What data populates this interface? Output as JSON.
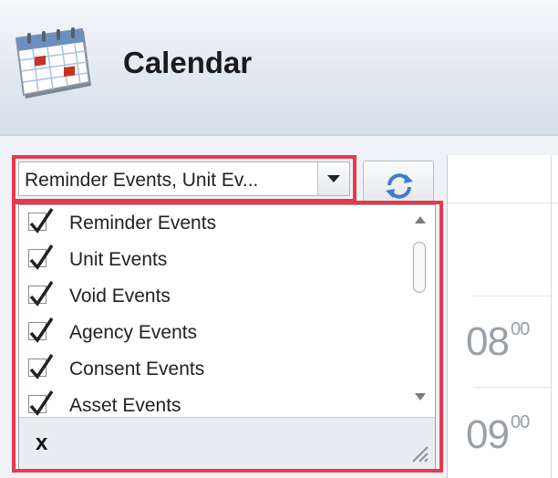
{
  "app": {
    "title": "Calendar",
    "icon": "calendar-icon"
  },
  "filter_combo": {
    "value": "Reminder Events, Unit Ev...",
    "dropdown_icon": "chevron-down-icon"
  },
  "refresh_button": {
    "icon": "refresh-icon"
  },
  "event_list": {
    "items": [
      {
        "label": "Reminder Events",
        "checked": true
      },
      {
        "label": "Unit Events",
        "checked": true
      },
      {
        "label": "Void Events",
        "checked": true
      },
      {
        "label": "Agency Events",
        "checked": true
      },
      {
        "label": "Consent Events",
        "checked": true
      },
      {
        "label": "Asset Events",
        "checked": true
      }
    ],
    "close_label": "x"
  },
  "day_view": {
    "hours": [
      {
        "hour": "08",
        "minutes": "00"
      },
      {
        "hour": "09",
        "minutes": "00"
      }
    ]
  },
  "colors": {
    "highlight": "#e8394c",
    "header_bg": "#dde5ef"
  }
}
